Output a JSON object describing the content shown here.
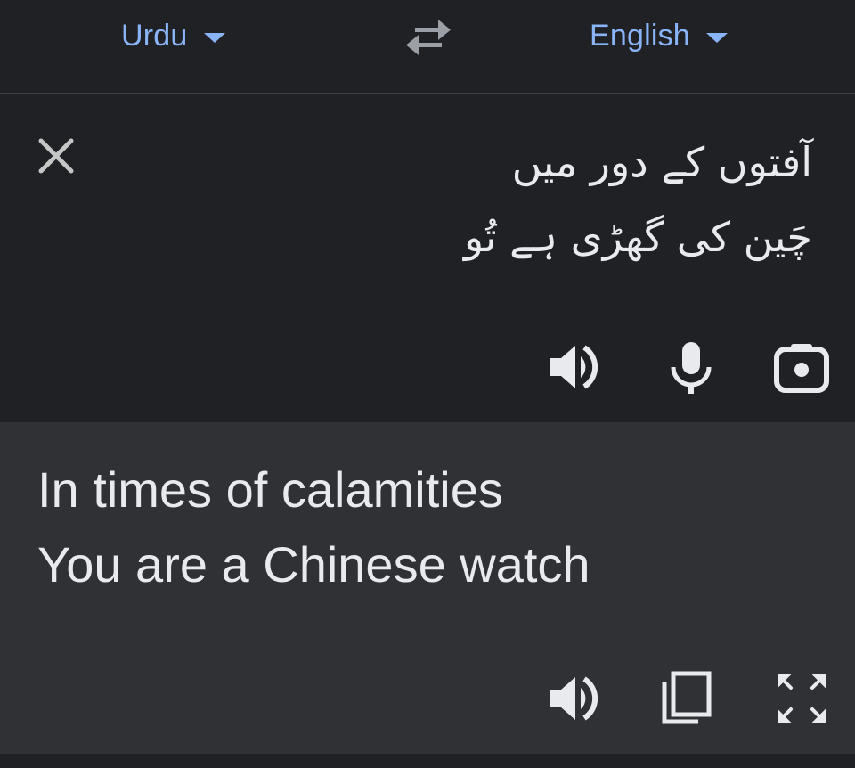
{
  "language_bar": {
    "source_language": "Urdu",
    "target_language": "English",
    "swap_icon": "swap-arrows-icon"
  },
  "source": {
    "lines": [
      "آفتوں کے دور میں",
      "چَین کی گھڑی ہے تُو"
    ],
    "icons": [
      "close-icon",
      "speaker-icon",
      "microphone-icon",
      "camera-icon"
    ]
  },
  "result": {
    "lines": [
      "In times of calamities",
      "You are a Chinese watch"
    ],
    "icons": [
      "speaker-icon",
      "copy-icon",
      "fullscreen-icon"
    ]
  },
  "colors": {
    "background": "#202125",
    "result_background": "#303134",
    "accent": "#8ab4f8",
    "text": "#e8eaed",
    "icon": "#e8eaed"
  }
}
